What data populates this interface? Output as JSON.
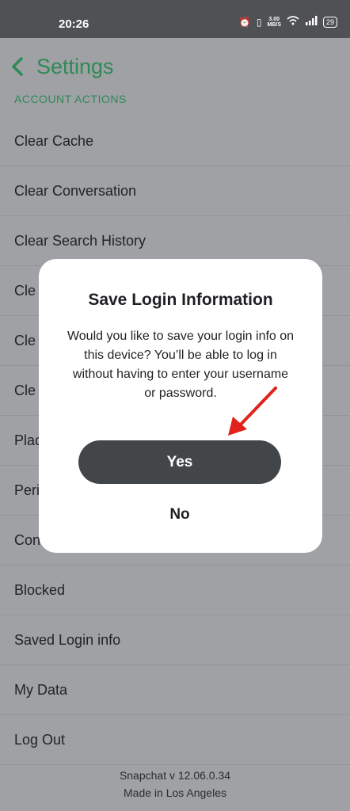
{
  "status": {
    "time": "20:26",
    "speed_top": "3.00",
    "speed_bottom": "MB/S",
    "battery": "29"
  },
  "header": {
    "title": "Settings",
    "back_icon": "chevron-left-icon"
  },
  "section": {
    "label": "ACCOUNT ACTIONS"
  },
  "list": {
    "items": [
      {
        "label": "Clear Cache"
      },
      {
        "label": "Clear Conversation"
      },
      {
        "label": "Clear Search History"
      },
      {
        "label": "Cle"
      },
      {
        "label": "Cle"
      },
      {
        "label": "Cle"
      },
      {
        "label": "Plac"
      },
      {
        "label": "Peri"
      },
      {
        "label": "Con"
      },
      {
        "label": "Blocked"
      },
      {
        "label": "Saved Login info"
      },
      {
        "label": "My Data"
      },
      {
        "label": "Log Out"
      }
    ]
  },
  "footer": {
    "version": "Snapchat v 12.06.0.34",
    "made_in": "Made in Los Angeles"
  },
  "dialog": {
    "title": "Save Login Information",
    "body": "Would you like to save your login info on this device? You’ll be able to log in without having to enter your username or password.",
    "yes_label": "Yes",
    "no_label": "No"
  },
  "colors": {
    "accent": "#2e8a57",
    "annotation_arrow": "#e0241b",
    "button": "#434649"
  }
}
